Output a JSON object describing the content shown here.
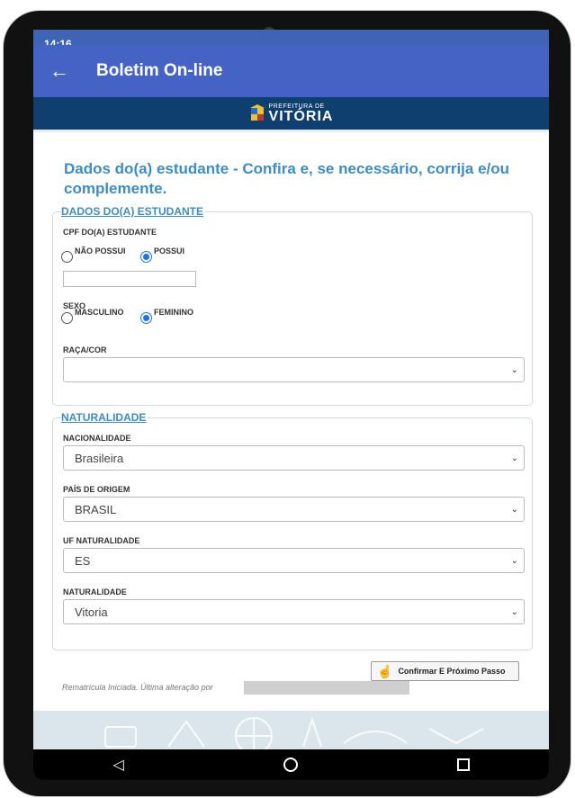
{
  "statusbar": {
    "time": "14:16"
  },
  "appbar": {
    "title": "Boletim On-line"
  },
  "banner": {
    "small": "PREFEITURA DE",
    "big": "VITÓRIA"
  },
  "page": {
    "heading": "Dados do(a) estudante - Confira e, se necessário, corrija e/ou complemente."
  },
  "student": {
    "legend": "DADOS DO(A) ESTUDANTE",
    "cpf_label": "CPF DO(A) ESTUDANTE",
    "cpf_no": "NÃO POSSUI",
    "cpf_yes": "POSSUI",
    "cpf_value": "",
    "sexo_label": "SEXO",
    "sexo_m": "MASCULINO",
    "sexo_f": "FEMININO",
    "raca_label": "RAÇA/COR",
    "raca_value": ""
  },
  "naturalidade": {
    "legend": "NATURALIDADE",
    "nacionalidade_label": "NACIONALIDADE",
    "nacionalidade_value": "Brasileira",
    "pais_label": "PAÍS DE ORIGEM",
    "pais_value": "BRASIL",
    "uf_label": "UF NATURALIDADE",
    "uf_value": "ES",
    "nat_label": "NATURALIDADE",
    "nat_value": "Vitoria"
  },
  "actions": {
    "confirm": "Confirmar E Próximo Passo"
  },
  "status": {
    "text": "Rematrícula Iniciada. Última alteração por"
  },
  "colors": {
    "appbar": "#4563c4",
    "banner": "#0e3f6e",
    "heading": "#3c8dc5",
    "radio_checked": "#1a73e8"
  }
}
